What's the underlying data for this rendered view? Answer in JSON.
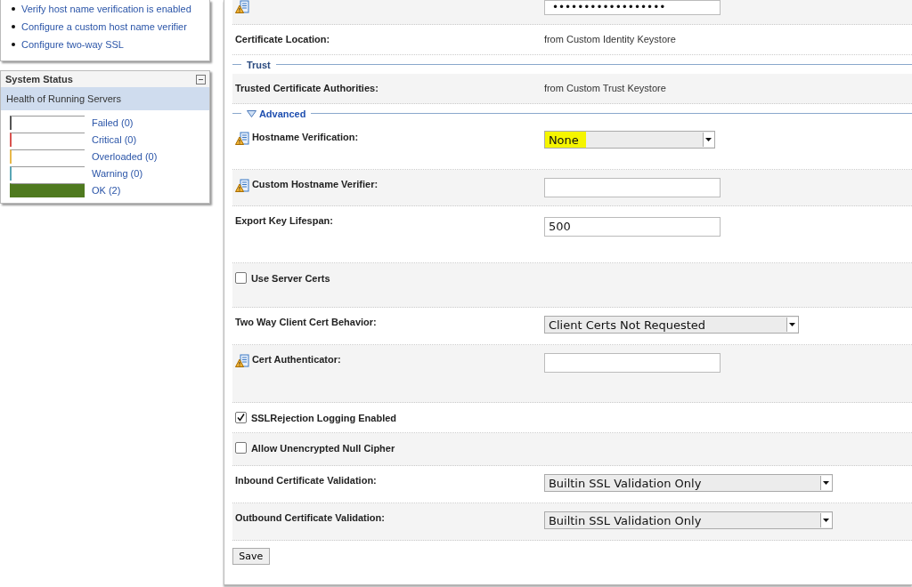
{
  "help_links": [
    "Verify host name verification is enabled",
    "Configure a custom host name verifier",
    "Configure two-way SSL"
  ],
  "system_status": {
    "title": "System Status",
    "subtitle": "Health of Running Servers",
    "items": [
      {
        "label": "Failed (0)",
        "color": "#555555",
        "level": 0
      },
      {
        "label": "Critical (0)",
        "color": "#d9534f",
        "level": 0
      },
      {
        "label": "Overloaded (0)",
        "color": "#e8b84a",
        "level": 0
      },
      {
        "label": "Warning (0)",
        "color": "#5aa6b5",
        "level": 0
      },
      {
        "label": "OK (2)",
        "color": "#4f7a1f",
        "level": 1
      }
    ]
  },
  "form": [
    {
      "kind": "password",
      "icon": true,
      "value": "••••••••••••••••••"
    },
    {
      "kind": "static",
      "label": "Certificate Location:",
      "value": "from Custom Identity Keystore"
    },
    {
      "kind": "section",
      "label": "Trust",
      "expandable": false
    },
    {
      "kind": "static",
      "label": "Trusted Certificate Authorities:",
      "value": "from Custom Trust Keystore"
    },
    {
      "kind": "section",
      "label": "Advanced",
      "expandable": true
    },
    {
      "kind": "select",
      "icon": true,
      "label": "Hostname Verification:",
      "value": "None",
      "highlighted": true
    },
    {
      "kind": "input",
      "icon": true,
      "label": "Custom Hostname Verifier:"
    },
    {
      "kind": "input",
      "icon": false,
      "label": "Export Key Lifespan:",
      "value": "500"
    },
    {
      "kind": "checkbox",
      "label": "Use Server Certs",
      "checked": false
    },
    {
      "kind": "select",
      "icon": false,
      "label": "Two Way Client Cert Behavior:",
      "value": "Client Certs Not Requested",
      "highlighted": false
    },
    {
      "kind": "input",
      "icon": true,
      "label": "Cert Authenticator:"
    },
    {
      "kind": "checkbox",
      "label": "SSLRejection Logging Enabled",
      "checked": true
    },
    {
      "kind": "checkbox",
      "label": "Allow Unencrypted Null Cipher",
      "checked": false
    },
    {
      "kind": "select",
      "icon": false,
      "label": "Inbound Certificate Validation:",
      "value": "Builtin SSL Validation Only",
      "highlighted": false
    },
    {
      "kind": "select",
      "icon": false,
      "label": "Outbound Certificate Validation:",
      "value": "Builtin SSL Validation Only",
      "highlighted": false
    }
  ],
  "save_button": "Save"
}
